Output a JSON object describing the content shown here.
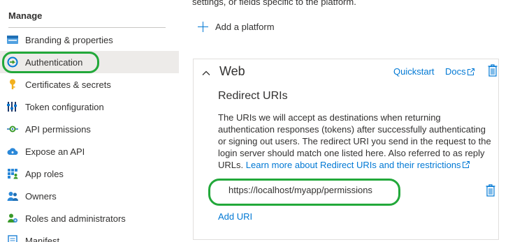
{
  "sidebar": {
    "heading": "Manage",
    "items": [
      {
        "label": "Branding & properties",
        "icon": "branding-icon",
        "active": false
      },
      {
        "label": "Authentication",
        "icon": "authentication-icon",
        "active": true
      },
      {
        "label": "Certificates & secrets",
        "icon": "key-icon",
        "active": false
      },
      {
        "label": "Token configuration",
        "icon": "token-config-icon",
        "active": false
      },
      {
        "label": "API permissions",
        "icon": "api-permissions-icon",
        "active": false
      },
      {
        "label": "Expose an API",
        "icon": "cloud-icon",
        "active": false
      },
      {
        "label": "App roles",
        "icon": "app-roles-icon",
        "active": false
      },
      {
        "label": "Owners",
        "icon": "owners-icon",
        "active": false
      },
      {
        "label": "Roles and administrators",
        "icon": "roles-admins-icon",
        "active": false
      },
      {
        "label": "Manifest",
        "icon": "manifest-icon",
        "active": false
      }
    ]
  },
  "main": {
    "top_text": "settings, or fields specific to the platform.",
    "add_platform_label": "Add a platform",
    "web_card": {
      "title": "Web",
      "quickstart_label": "Quickstart",
      "docs_label": "Docs",
      "section_title": "Redirect URIs",
      "description": "The URIs we will accept as destinations when returning authentication responses (tokens) after successfully authenticating or signing out users. The redirect URI you send in the request to the login server should match one listed here. Also referred to as reply URLs.",
      "learn_more_link": "Learn more about Redirect URIs and their restrictions",
      "redirect_uris": [
        "https://localhost/myapp/permissions"
      ],
      "add_uri_label": "Add URI"
    }
  },
  "colors": {
    "link": "#0078d4",
    "highlight": "#22a83a",
    "active_bg": "#edebe9"
  }
}
